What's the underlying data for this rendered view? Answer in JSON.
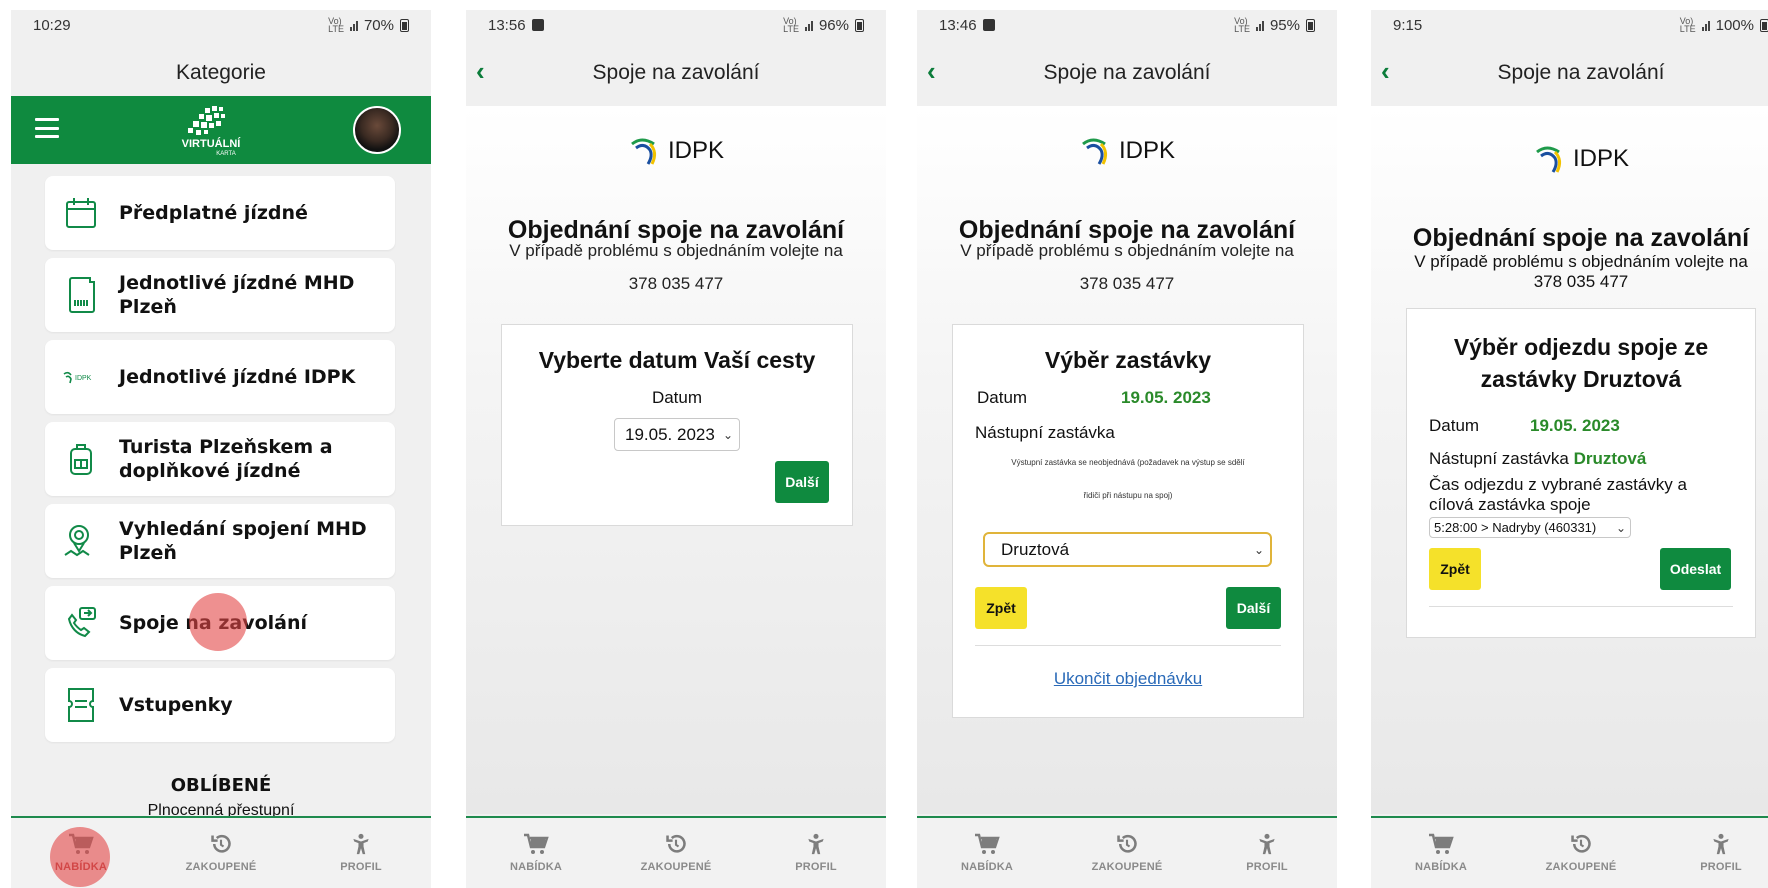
{
  "screens": {
    "s1": {
      "status": {
        "time": "10:29",
        "battery": "70%"
      },
      "title": "Kategorie",
      "logo_text": "VIRTUÁLNÍ",
      "logo_sub": "KARTA",
      "menu": [
        {
          "label": "Předplatné jízdné",
          "icon": "calendar-icon"
        },
        {
          "label": "Jednotlivé jízdné MHD Plzeň",
          "icon": "sim-ticket-icon"
        },
        {
          "label": "Jednotlivé jízdné IDPK",
          "icon": "idpk-logo-icon"
        },
        {
          "label": "Turista Plzeňskem a doplňkové jízdné",
          "icon": "backpack-icon"
        },
        {
          "label": "Vyhledání spojení MHD Plzeň",
          "icon": "map-pin-icon"
        },
        {
          "label": "Spoje na zavolání",
          "icon": "phone-icon"
        },
        {
          "label": "Vstupenky",
          "icon": "ticket-icon"
        }
      ],
      "favorites_title": "OBLÍBENÉ",
      "favorites_item": "Plnocenná přestupní"
    },
    "s2": {
      "status": {
        "time": "13:56",
        "battery": "96%"
      },
      "title": "Spoje na zavolání",
      "brand": "IDPK",
      "heading": "Objednání spoje na zavolání",
      "subtitle": "V případě problému s objednáním volejte na",
      "phone": "378 035 477",
      "box_title": "Vyberte datum Vaší cesty",
      "date_label": "Datum",
      "date_value": "19.05. 2023",
      "next_label": "Další"
    },
    "s3": {
      "status": {
        "time": "13:46",
        "battery": "95%"
      },
      "title": "Spoje na zavolání",
      "brand": "IDPK",
      "heading": "Objednání spoje na zavolání",
      "subtitle": "V případě problému s objednáním volejte na",
      "phone": "378 035 477",
      "box_title": "Výběr zastávky",
      "date_label": "Datum",
      "date_value": "19.05. 2023",
      "stop_label": "Nástupní zastávka",
      "note_line1": "Výstupní zastávka se neobjednává (požadavek na výstup se sdělí",
      "note_line2": "řidiči při nástupu na spoj)",
      "stop_value": "Druztová",
      "back_label": "Zpět",
      "next_label": "Další",
      "cancel_link": "Ukončit objednávku"
    },
    "s4": {
      "status": {
        "time": "9:15",
        "battery": "100%"
      },
      "title": "Spoje na zavolání",
      "brand": "IDPK",
      "heading": "Objednání spoje na zavolání",
      "subtitle": "V případě problému s objednáním volejte na",
      "phone": "378 035 477",
      "box_title": "Výběr odjezdu spoje ze zastávky Druztová",
      "date_label": "Datum",
      "date_value": "19.05. 2023",
      "stop_label": "Nástupní zastávka",
      "stop_value": "Druztová",
      "departure_label": "Čas odjezdu z vybrané zastávky a cílová zastávka spoje",
      "departure_value": "5:28:00 > Nadryby (460331)",
      "back_label": "Zpět",
      "send_label": "Odeslat"
    }
  },
  "nav": {
    "offer": "NABÍDKA",
    "purchased": "ZAKOUPENÉ",
    "profile": "PROFIL"
  },
  "colors": {
    "brand_green": "#0f8a3f",
    "value_green": "#2a8a2a",
    "button_yellow": "#f5e12a",
    "tap_indicator": "#e24646"
  }
}
